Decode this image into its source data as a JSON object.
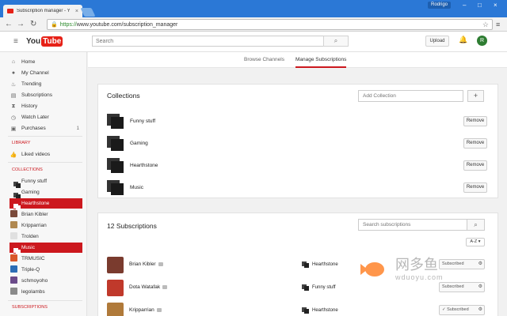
{
  "browser": {
    "tab_title": "Subscription manager - Y",
    "tab_close": "×",
    "user": "Rodrigo",
    "url_scheme": "https://",
    "url_rest": "www.youtube.com/subscription_manager",
    "lock": "🔒",
    "star": "☆",
    "menu": "≡",
    "back": "←",
    "forward": "→",
    "reload": "↻",
    "minimize": "–",
    "maximize": "□",
    "close": "×"
  },
  "masthead": {
    "logo_you": "You",
    "logo_tube": "Tube",
    "search_placeholder": "Search",
    "upload_label": "Upload",
    "avatar_letter": "R"
  },
  "sidebar": {
    "items": [
      {
        "label": "Home",
        "icon": "home-icon"
      },
      {
        "label": "My Channel",
        "icon": "user-icon"
      },
      {
        "label": "Trending",
        "icon": "flame-icon"
      },
      {
        "label": "Subscriptions",
        "icon": "subscriptions-icon"
      },
      {
        "label": "History",
        "icon": "hourglass-icon"
      },
      {
        "label": "Watch Later",
        "icon": "clock-icon"
      },
      {
        "label": "Purchases",
        "icon": "cart-icon",
        "count": "1"
      }
    ],
    "library_heading": "LIBRARY",
    "library_items": [
      {
        "label": "Liked videos",
        "icon": "thumbs-up-icon"
      }
    ],
    "collections_heading": "COLLECTIONS",
    "collection_items": [
      {
        "label": "Funny stuff",
        "type": "collection"
      },
      {
        "label": "Gaming",
        "type": "collection"
      },
      {
        "label": "Hearthstone",
        "type": "collection",
        "active": true
      },
      {
        "label": "Brian Kibler",
        "type": "channel",
        "color": "#7a4a3a"
      },
      {
        "label": "Kripparrian",
        "type": "channel",
        "color": "#b08850"
      },
      {
        "label": "Trolden",
        "type": "channel",
        "color": "#e0e0e0"
      },
      {
        "label": "Music",
        "type": "collection",
        "active": true
      },
      {
        "label": "TRMUSIC",
        "type": "channel",
        "color": "#d9572a"
      },
      {
        "label": "Triple-Q",
        "type": "channel",
        "color": "#2c6db5"
      },
      {
        "label": "schmoyoho",
        "type": "channel",
        "color": "#6b4b8a"
      },
      {
        "label": "legolambs",
        "type": "channel",
        "color": "#8a8a8a"
      }
    ],
    "subscriptions_heading": "SUBSCRIPTIONS"
  },
  "page_tabs": [
    {
      "label": "Browse Channels",
      "active": false
    },
    {
      "label": "Manage Subscriptions",
      "active": true
    }
  ],
  "collections_card": {
    "title": "Collections",
    "add_placeholder": "Add Collection",
    "add_icon": "+",
    "rows": [
      {
        "name": "Funny stuff",
        "action": "Remove"
      },
      {
        "name": "Gaming",
        "action": "Remove"
      },
      {
        "name": "Hearthstone",
        "action": "Remove"
      },
      {
        "name": "Music",
        "action": "Remove"
      }
    ]
  },
  "subscriptions_card": {
    "title": "12 Subscriptions",
    "search_placeholder": "Search subscriptions",
    "sort_label": "A-Z ▾",
    "rows": [
      {
        "name": "Brian Kibler",
        "collection": "Hearthstone",
        "status": "Subscribed",
        "color": "#7a3b2e"
      },
      {
        "name": "Dota Watafak",
        "collection": "Funny stuff",
        "status": "Subscribed",
        "color": "#c0392b"
      },
      {
        "name": "Kripparrian",
        "collection": "Hearthstone",
        "status": "✓ Subscribed",
        "color": "#b07a3a"
      }
    ]
  },
  "watermark": {
    "chinese": "网多鱼",
    "english": "wduoyu.com"
  },
  "colors": {
    "chrome_blue": "#2b78d6",
    "youtube_red": "#e62117",
    "active_red": "#cc181e"
  }
}
